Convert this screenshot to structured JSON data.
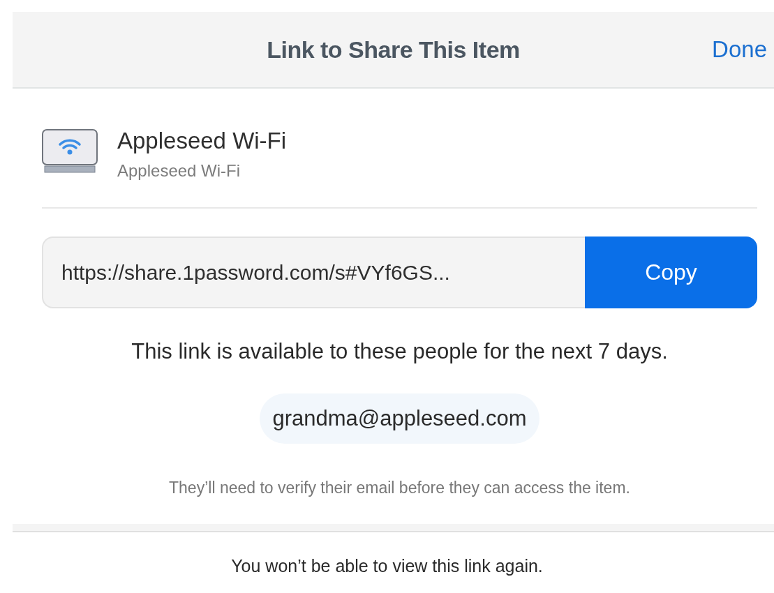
{
  "header": {
    "title": "Link to Share This Item",
    "done": "Done"
  },
  "item": {
    "title": "Appleseed Wi-Fi",
    "subtitle": "Appleseed Wi-Fi"
  },
  "link": {
    "value": "https://share.1password.com/s#VYf6GS...",
    "copy": "Copy"
  },
  "availability": "This link is available to these people for the next 7 days.",
  "recipients": [
    "grandma@appleseed.com"
  ],
  "note": "They’ll need to verify their email before they can access the item.",
  "footer": "You won’t be able to view this link again."
}
